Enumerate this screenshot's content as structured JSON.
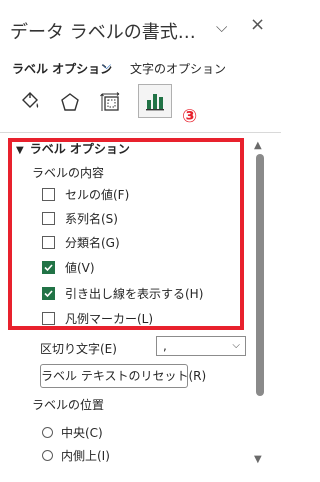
{
  "pane": {
    "title": "データ ラベルの書式…",
    "collapse_glyph": "⌵",
    "close_glyph": "×"
  },
  "subtabs": {
    "active": "ラベル オプション",
    "chevron": "⌵",
    "other": "文字のオプション"
  },
  "icon_tabs": [
    "fill-line-icon",
    "effects-pentagon-icon",
    "size-properties-icon",
    "label-options-bar-chart-icon"
  ],
  "step_badge": "③",
  "section": {
    "chevron": "▼",
    "title": "ラベル オプション",
    "contents_label": "ラベルの内容",
    "options": [
      {
        "label": "セルの値(F)",
        "checked": false
      },
      {
        "label": "系列名(S)",
        "checked": false
      },
      {
        "label": "分類名(G)",
        "checked": false
      },
      {
        "label": "値(V)",
        "checked": true
      },
      {
        "label": "引き出し線を表示する(H)",
        "checked": true
      },
      {
        "label": "凡例マーカー(L)",
        "checked": false
      }
    ],
    "separator_label": "区切り文字(E)",
    "separator_value": ",",
    "separator_chevron": "⌵",
    "reset_button": "ラベル テキストのリセット(R)",
    "position_label": "ラベルの位置",
    "positions": [
      {
        "label": "中央(C)",
        "selected": false
      },
      {
        "label": "内側上(I)",
        "selected": false
      }
    ]
  },
  "scrollbar": {
    "up": "▲",
    "down": "▼"
  },
  "colors": {
    "highlight": "#e8212d",
    "accent": "#2d6fc0",
    "checkbox_checked": "#217346",
    "chart_icon": "#217346"
  }
}
